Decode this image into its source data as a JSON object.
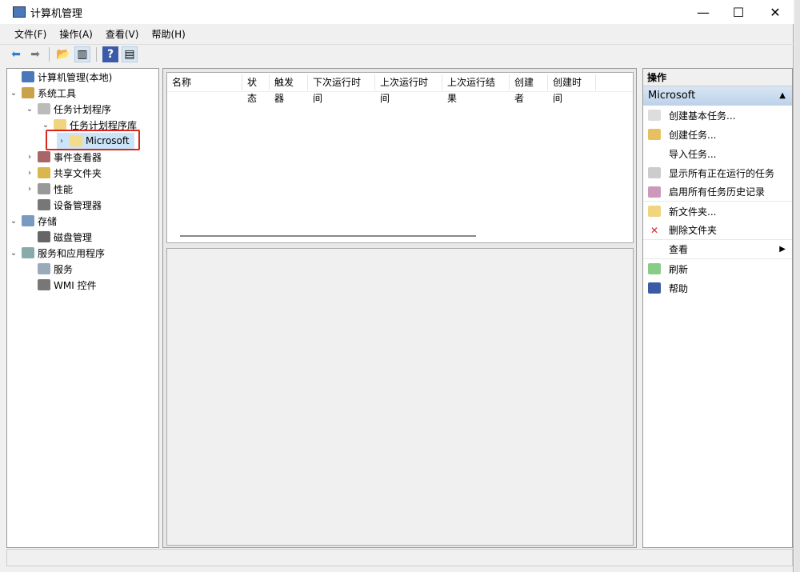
{
  "window": {
    "title": "计算机管理",
    "minimize": "—",
    "maximize": "☐",
    "close": "✕"
  },
  "menu": [
    "文件(F)",
    "操作(A)",
    "查看(V)",
    "帮助(H)"
  ],
  "tree": [
    {
      "label": "计算机管理(本地)",
      "chev": "",
      "icon": "computer-management-icon",
      "color": "#4a78b8"
    },
    {
      "label": "系统工具",
      "chev": "⌄",
      "icon": "tools-icon",
      "color": "#c9a24a"
    },
    {
      "label": "任务计划程序",
      "chev": "⌄",
      "icon": "clock-icon",
      "color": "#bbb"
    },
    {
      "label": "任务计划程序库",
      "chev": "⌄",
      "icon": "folder-clock-icon",
      "color": "#f1d47e"
    },
    {
      "label": "Microsoft",
      "chev": "›",
      "icon": "folder-icon",
      "color": "#f4dc8a"
    },
    {
      "label": "事件查看器",
      "chev": "›",
      "icon": "event-viewer-icon",
      "color": "#a66"
    },
    {
      "label": "共享文件夹",
      "chev": "›",
      "icon": "shared-folder-icon",
      "color": "#d9b64e"
    },
    {
      "label": "性能",
      "chev": "›",
      "icon": "performance-icon",
      "color": "#999"
    },
    {
      "label": "设备管理器",
      "chev": "",
      "icon": "device-manager-icon",
      "color": "#777"
    },
    {
      "label": "存储",
      "chev": "⌄",
      "icon": "storage-icon",
      "color": "#7a9abf"
    },
    {
      "label": "磁盘管理",
      "chev": "",
      "icon": "disk-icon",
      "color": "#666"
    },
    {
      "label": "服务和应用程序",
      "chev": "⌄",
      "icon": "services-apps-icon",
      "color": "#8aa"
    },
    {
      "label": "服务",
      "chev": "",
      "icon": "services-icon",
      "color": "#9ab"
    },
    {
      "label": "WMI 控件",
      "chev": "",
      "icon": "wmi-icon",
      "color": "#777"
    }
  ],
  "columns": [
    "名称",
    "状态",
    "触发器",
    "下次运行时间",
    "上次运行时间",
    "上次运行结果",
    "创建者",
    "创建时间"
  ],
  "actions": {
    "header": "操作",
    "section": "Microsoft",
    "items": [
      {
        "label": "创建基本任务...",
        "icon": "create-basic-task-icon",
        "color": "#ddd"
      },
      {
        "label": "创建任务...",
        "icon": "create-task-icon",
        "color": "#e8c060"
      },
      {
        "label": "导入任务...",
        "icon": "",
        "color": ""
      },
      {
        "label": "显示所有正在运行的任务",
        "icon": "running-tasks-icon",
        "color": "#ccc"
      },
      {
        "label": "启用所有任务历史记录",
        "icon": "history-icon",
        "color": "#c9b"
      },
      {
        "label": "新文件夹...",
        "icon": "new-folder-icon",
        "color": "#f1d47e"
      },
      {
        "label": "删除文件夹",
        "icon": "delete-icon",
        "color": ""
      },
      {
        "label": "查看",
        "icon": "",
        "color": ""
      },
      {
        "label": "刷新",
        "icon": "refresh-icon",
        "color": "#8c8"
      },
      {
        "label": "帮助",
        "icon": "help-icon",
        "color": "#3b5ba8"
      }
    ]
  }
}
